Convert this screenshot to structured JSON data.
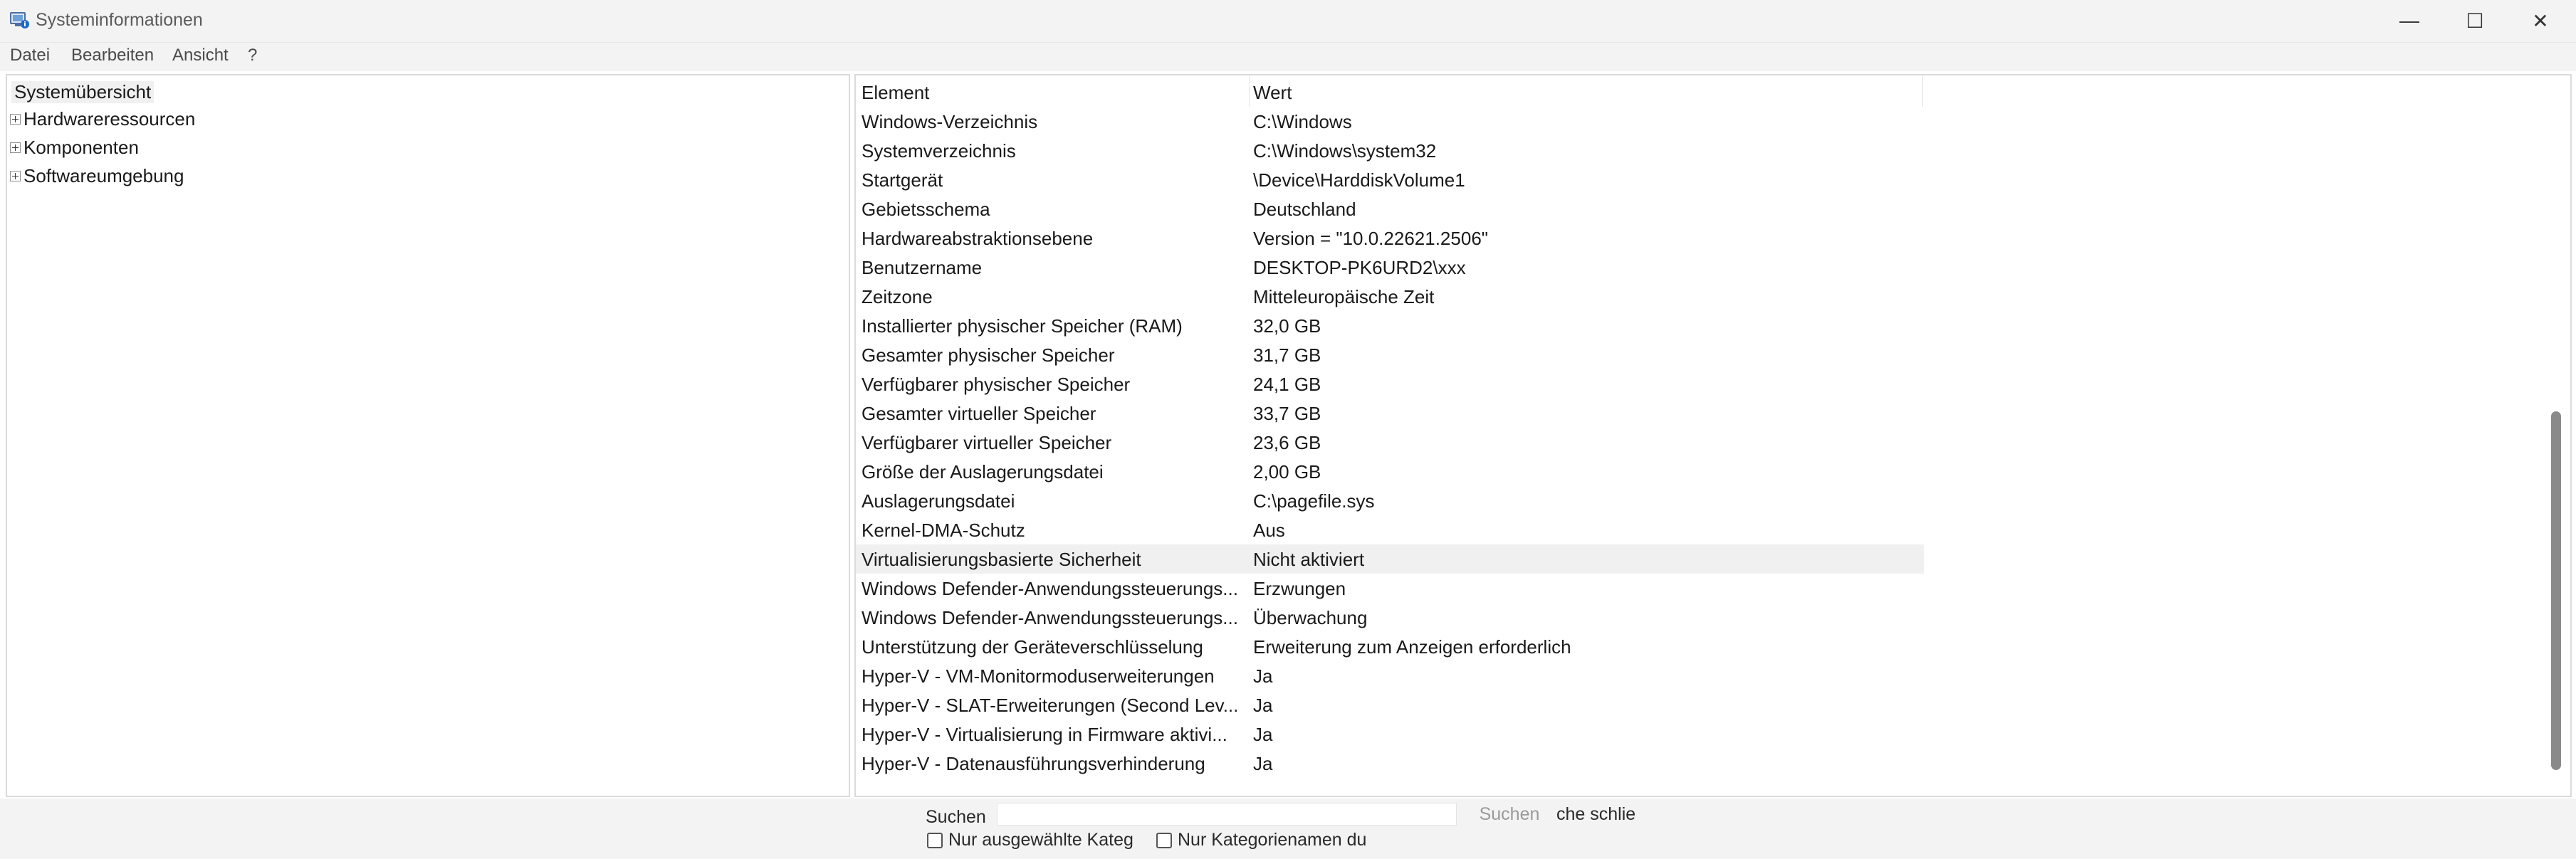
{
  "window": {
    "title": "Systeminformationen",
    "icon": "system-information-icon",
    "controls": {
      "minimize": "—",
      "maximize": "☐",
      "close": "✕"
    }
  },
  "menu": [
    "Datei",
    "Bearbeiten",
    "Ansicht",
    "?"
  ],
  "tree": {
    "root": "Systemübersicht",
    "items": [
      "Hardwareressourcen",
      "Komponenten",
      "Softwareumgebung"
    ]
  },
  "list": {
    "headers": {
      "element": "Element",
      "value": "Wert"
    },
    "rows": [
      {
        "element": "Windows-Verzeichnis",
        "value": "C:\\Windows"
      },
      {
        "element": "Systemverzeichnis",
        "value": "C:\\Windows\\system32"
      },
      {
        "element": "Startgerät",
        "value": "\\Device\\HarddiskVolume1"
      },
      {
        "element": "Gebietsschema",
        "value": "Deutschland"
      },
      {
        "element": "Hardwareabstraktionsebene",
        "value": "Version = \"10.0.22621.2506\""
      },
      {
        "element": "Benutzername",
        "value": "DESKTOP-PK6URD2\\xxx"
      },
      {
        "element": "Zeitzone",
        "value": "Mitteleuropäische Zeit"
      },
      {
        "element": "Installierter physischer Speicher (RAM)",
        "value": "32,0 GB"
      },
      {
        "element": "Gesamter physischer Speicher",
        "value": "31,7 GB"
      },
      {
        "element": "Verfügbarer physischer Speicher",
        "value": "24,1 GB"
      },
      {
        "element": "Gesamter virtueller Speicher",
        "value": "33,7 GB"
      },
      {
        "element": "Verfügbarer virtueller Speicher",
        "value": "23,6 GB"
      },
      {
        "element": "Größe der Auslagerungsdatei",
        "value": "2,00 GB"
      },
      {
        "element": "Auslagerungsdatei",
        "value": "C:\\pagefile.sys"
      },
      {
        "element": "Kernel-DMA-Schutz",
        "value": "Aus"
      },
      {
        "element": "Virtualisierungsbasierte Sicherheit",
        "value": "Nicht aktiviert",
        "selected": true
      },
      {
        "element": "Windows Defender-Anwendungssteuerungs...",
        "value": "Erzwungen"
      },
      {
        "element": "Windows Defender-Anwendungssteuerungs...",
        "value": "Überwachung"
      },
      {
        "element": "Unterstützung der Geräteverschlüsselung",
        "value": "Erweiterung zum Anzeigen erforderlich"
      },
      {
        "element": "Hyper-V - VM-Monitormoduserweiterungen",
        "value": "Ja"
      },
      {
        "element": "Hyper-V - SLAT-Erweiterungen (Second Lev...",
        "value": "Ja"
      },
      {
        "element": "Hyper-V - Virtualisierung in Firmware aktivi...",
        "value": "Ja"
      },
      {
        "element": "Hyper-V - Datenausführungsverhinderung",
        "value": "Ja"
      }
    ]
  },
  "search": {
    "label": "Suchen",
    "input_value": "",
    "button": "Suchen",
    "close_button": "Suche schließen",
    "close_button_visible": "che schlie",
    "checkbox_selected_category": "Nur ausgewählte Kateg",
    "checkbox_category_names": "Nur Kategorienamen du"
  },
  "colors": {
    "selection": "#f0f0f0",
    "chrome": "#f3f3f3",
    "scroll_thumb": "#8a8a8a"
  }
}
